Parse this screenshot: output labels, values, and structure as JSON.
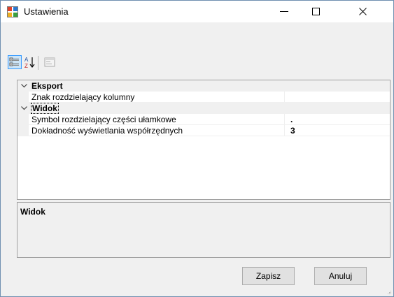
{
  "window": {
    "title": "Ustawienia"
  },
  "toolbar": {
    "categorized_icon": "categorized-view-icon",
    "alphabetical_icon": "sort-alphabetical-icon",
    "property_pages_icon": "property-pages-icon"
  },
  "grid": {
    "categories": [
      {
        "name": "Eksport",
        "properties": [
          {
            "name": "Znak rozdzielający kolumny",
            "value": ""
          }
        ]
      },
      {
        "name": "Widok",
        "properties": [
          {
            "name": "Symbol rozdzielający części ułamkowe",
            "value": "."
          },
          {
            "name": "Dokładność wyświetlania współrzędnych",
            "value": "3"
          }
        ]
      }
    ]
  },
  "help": {
    "title": "Widok"
  },
  "buttons": {
    "save": "Zapisz",
    "cancel": "Anuluj"
  },
  "colors": {
    "selection_border": "#3399ff",
    "selection_fill": "#cce4f7",
    "window_bg": "#f0f0f0"
  }
}
